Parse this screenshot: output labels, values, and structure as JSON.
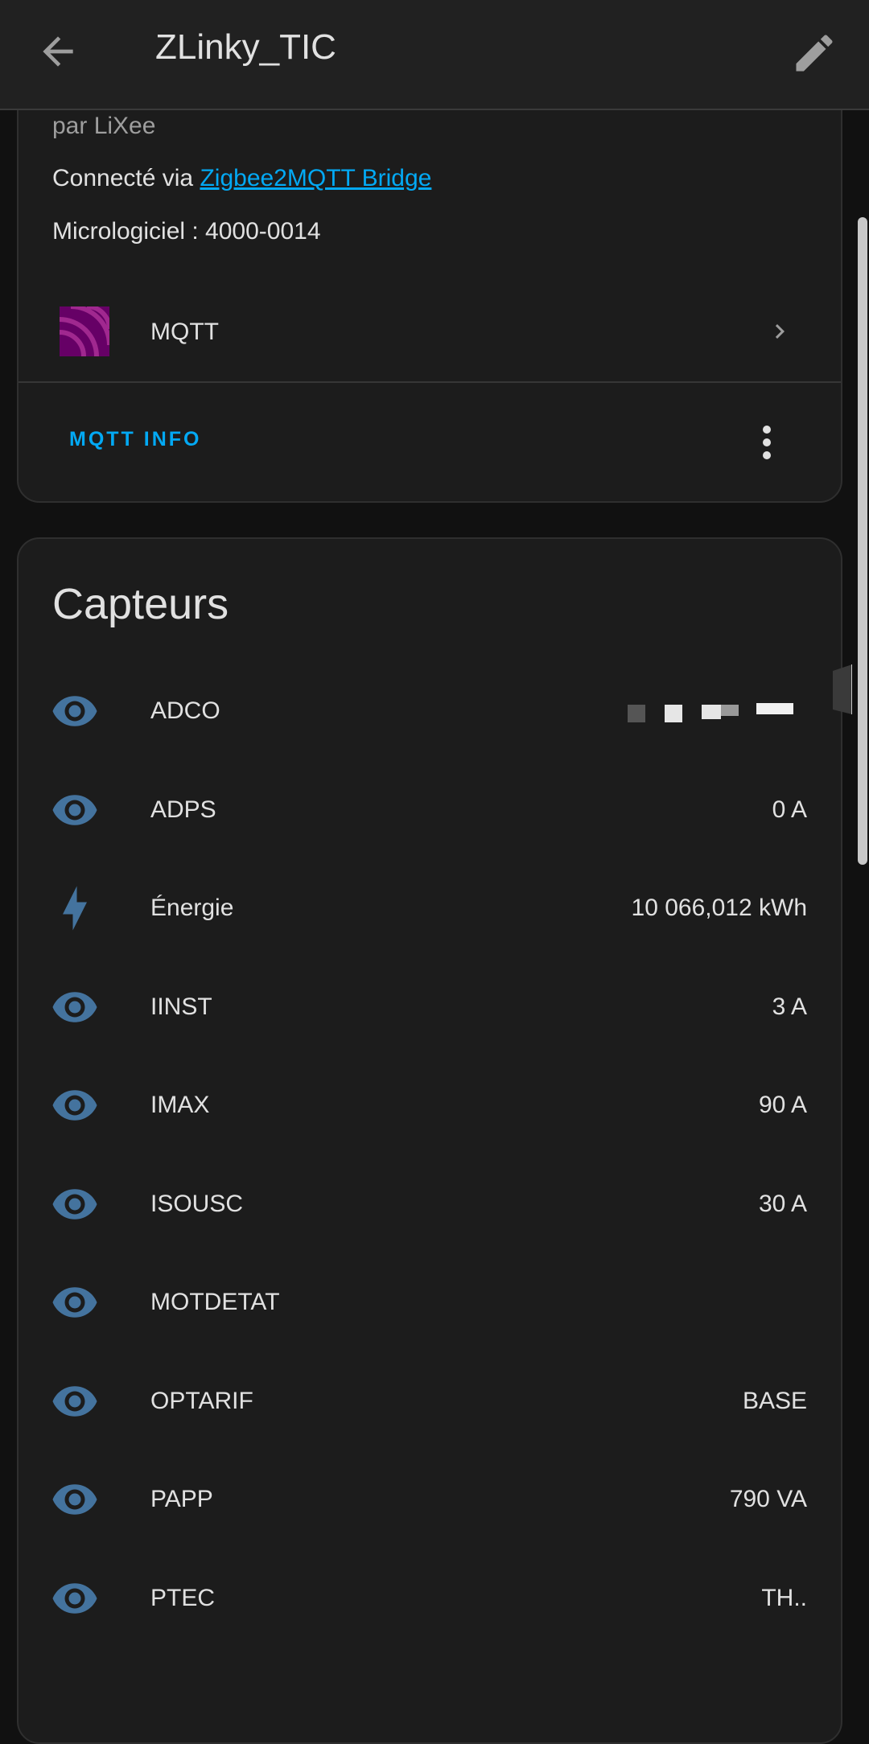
{
  "app_bar": {
    "title": "ZLinky_TIC"
  },
  "device": {
    "maker": "par LiXee",
    "via_prefix": "Connecté via ",
    "via_link": "Zigbee2MQTT Bridge",
    "firmware": "Micrologiciel : 4000-0014",
    "integration_label": "MQTT",
    "action_label": "MQTT INFO"
  },
  "sensors": {
    "title": "Capteurs",
    "items": [
      {
        "name": "ADCO",
        "value": "",
        "icon": "eye-icon",
        "redacted": true
      },
      {
        "name": "ADPS",
        "value": "0 A",
        "icon": "eye-icon"
      },
      {
        "name": "Énergie",
        "value": "10 066,012 kWh",
        "icon": "lightning-bolt-icon"
      },
      {
        "name": "IINST",
        "value": "3 A",
        "icon": "eye-icon"
      },
      {
        "name": "IMAX",
        "value": "90 A",
        "icon": "eye-icon"
      },
      {
        "name": "ISOUSC",
        "value": "30 A",
        "icon": "eye-icon"
      },
      {
        "name": "MOTDETAT",
        "value": "",
        "icon": "eye-icon"
      },
      {
        "name": "OPTARIF",
        "value": "BASE",
        "icon": "eye-icon"
      },
      {
        "name": "PAPP",
        "value": "790 VA",
        "icon": "eye-icon"
      },
      {
        "name": "PTEC",
        "value": "TH..",
        "icon": "eye-icon"
      }
    ]
  },
  "colors": {
    "accent": "#03a9f4",
    "icon_blue": "#44739e",
    "mqtt_logo": "#660066"
  }
}
